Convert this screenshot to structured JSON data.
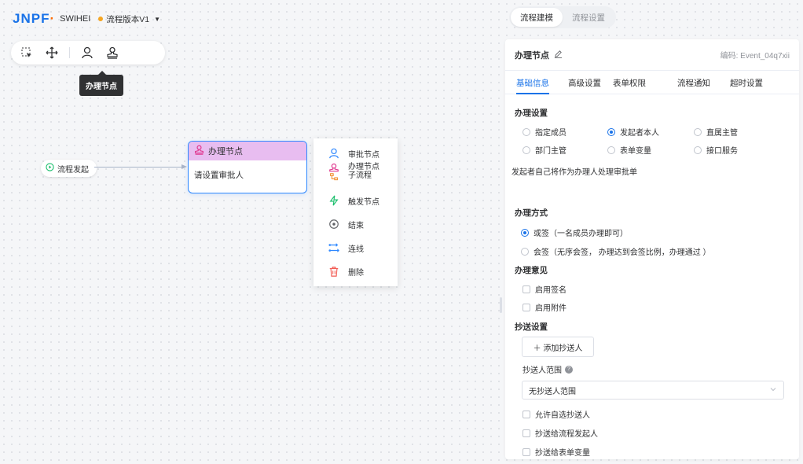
{
  "header": {
    "logo_main": "JNPF",
    "logo_accent": "·",
    "app_name": "SWIHEI",
    "version": "流程版本V1"
  },
  "toolbar": {
    "tooltip": "办理节点"
  },
  "canvas": {
    "start_node_label": "流程发起",
    "task_node_title": "办理节点",
    "task_node_body": "请设置审批人"
  },
  "context_menu": {
    "items": [
      {
        "label": "审批节点"
      },
      {
        "label": "办理节点"
      },
      {
        "label": "子流程"
      },
      {
        "label": "触发节点"
      },
      {
        "label": "结束"
      },
      {
        "label": "连线"
      },
      {
        "label": "删除"
      }
    ]
  },
  "top_tabs": [
    "流程建模",
    "流程设置"
  ],
  "panel": {
    "title": "办理节点",
    "code_label": "编码:",
    "code_value": "Event_04q7xii",
    "tabs": [
      "基础信息",
      "高级设置",
      "表单权限",
      "流程通知",
      "超时设置"
    ],
    "handler_settings": {
      "title": "办理设置",
      "options": [
        "指定成员",
        "发起者本人",
        "直属主管",
        "部门主管",
        "表单变量",
        "接口服务"
      ],
      "selected": "发起者本人",
      "description": "发起者自己将作为办理人处理审批单"
    },
    "handle_mode": {
      "title": "办理方式",
      "options": [
        "或签（一名成员办理即可）",
        "会签（无序会签， 办理达到会签比例，办理通过 ）"
      ],
      "selected": "或签（一名成员办理即可）"
    },
    "opinion": {
      "title": "办理意见",
      "checks": [
        "启用签名",
        "启用附件"
      ]
    },
    "cc": {
      "title": "抄送设置",
      "add_button": "＋ 添加抄送人",
      "scope_label": "抄送人范围",
      "scope_value": "无抄送人范围",
      "checks": [
        "允许自选抄送人",
        "抄送给流程发起人",
        "抄送给表单变量"
      ]
    }
  },
  "colors": {
    "primary": "#1a73e8",
    "task_header": "#e8bdf0",
    "accent_orange": "#ff6a00"
  }
}
